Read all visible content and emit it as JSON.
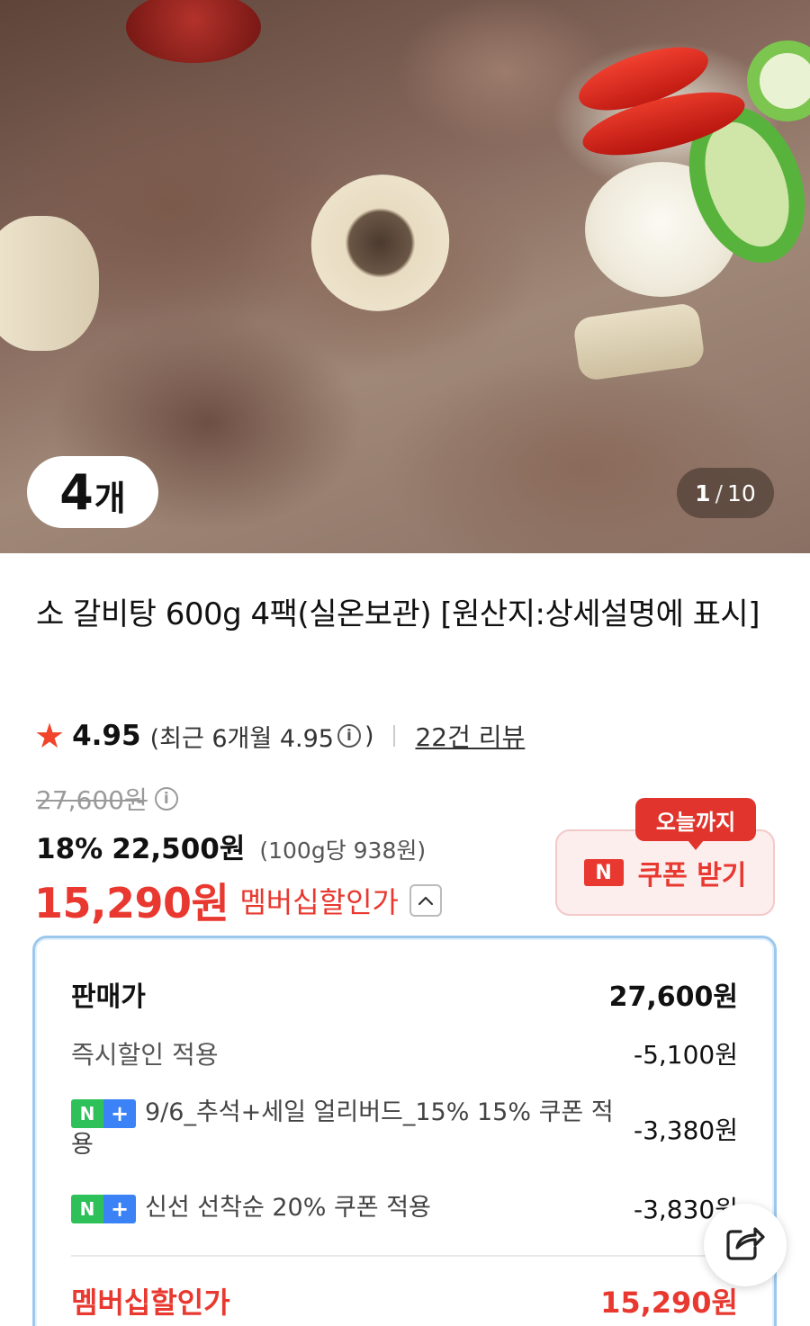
{
  "product_image": {
    "quantity_number": "4",
    "quantity_unit": "개",
    "pager_current": "1",
    "pager_separator": "/",
    "pager_total": "10"
  },
  "product": {
    "title": "소 갈비탕 600g 4팩(실온보관) [원산지:상세설명에 표시]"
  },
  "rating": {
    "score": "4.95",
    "recent_prefix": "(최근 6개월 4.95",
    "recent_suffix": ")",
    "info_symbol": "i",
    "review_link": "22건 리뷰"
  },
  "price": {
    "original": "27,600원",
    "discount_rate": "18%",
    "sale_price": "22,500원",
    "unit_price": "(100g당 938원)",
    "member_price": "15,290원",
    "member_label": "멤버십할인가"
  },
  "coupon": {
    "tag": "오늘까지",
    "n_logo": "N",
    "button_label": "쿠폰 받기"
  },
  "breakdown": {
    "list_price_label": "판매가",
    "list_price_value": "27,600원",
    "instant_label": "즉시할인 적용",
    "instant_value": "-5,100원",
    "np_n": "N",
    "np_plus": "+",
    "coupon1_label": "9/6_추석+세일 얼리버드_15% 15% 쿠폰 적용",
    "coupon1_value": "-3,380원",
    "coupon2_label": "신선 선착순 20% 쿠폰 적용",
    "coupon2_value": "-3,830원",
    "total_label": "멤버십할인가",
    "total_value": "15,290원"
  },
  "colors": {
    "accent_red": "#e8382f",
    "naver_green": "#2ec15a",
    "naver_blue": "#3b82f6",
    "panel_border": "#9cc8ee"
  },
  "icons": [
    "star-icon",
    "info-icon",
    "caret-up-icon",
    "naver-n-icon",
    "share-icon"
  ]
}
